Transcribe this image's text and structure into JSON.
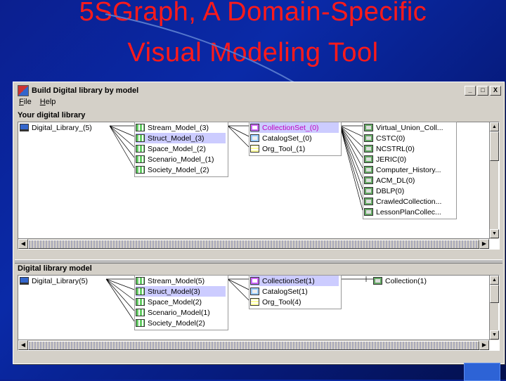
{
  "slide": {
    "title_line1": "5SGraph, A Domain-Specific",
    "title_line2": "Visual Modeling Tool",
    "title_color": "#ff1a1a",
    "background_color": "#0a2aa8"
  },
  "window": {
    "title": "Build Digital library by model",
    "menu": [
      {
        "label": "File",
        "accel": "F"
      },
      {
        "label": "Help",
        "accel": "H"
      }
    ],
    "buttons": {
      "minimize": "_",
      "maximize": "□",
      "close": "X"
    }
  },
  "top_panel": {
    "label": "Your digital library",
    "root": "Digital_Library_(5)",
    "models": [
      "Stream_Model_(3)",
      "Struct_Model_(3)",
      "Space_Model_(2)",
      "Scenario_Model_(1)",
      "Society_Model_(2)"
    ],
    "collections": [
      "CollectionSet_(0)",
      "CatalogSet_(0)",
      "Org_Tool_(1)"
    ],
    "libraries": [
      "Virtual_Union_Coll...",
      "CSTC(0)",
      "NCSTRL(0)",
      "JERIC(0)",
      "Computer_History...",
      "ACM_DL(0)",
      "DBLP(0)",
      "CrawledCollection...",
      "LessonPlanCollec..."
    ]
  },
  "bottom_panel": {
    "label": "Digital library model",
    "root": "Digital_Library(5)",
    "models": [
      "Stream_Model(5)",
      "Struct_Model(3)",
      "Space_Model(2)",
      "Scenario_Model(1)",
      "Society_Model(2)"
    ],
    "collections": [
      "CollectionSet(1)",
      "CatalogSet(1)",
      "Org_Tool(4)"
    ],
    "collection_leaf": "Collection(1)"
  }
}
